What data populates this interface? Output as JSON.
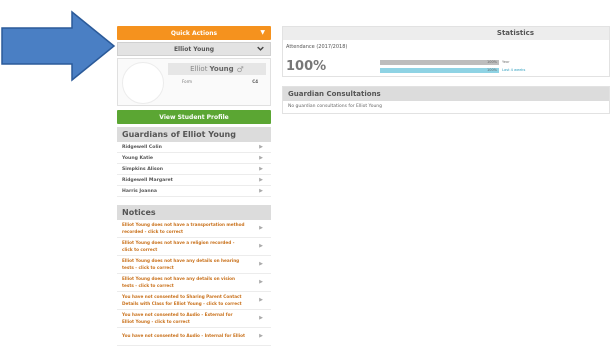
{
  "quick_actions": {
    "label": "Quick Actions",
    "caret": "▼"
  },
  "student_select": {
    "value": "Elliot Young",
    "chevron_icon": "chevron-down-icon"
  },
  "profile": {
    "given_name": "Elliot",
    "family_name": "Young",
    "gender_symbol": "♂",
    "field_label": "Form",
    "field_value": "C4"
  },
  "view_profile_label": "View Student Profile",
  "guardians": {
    "title": "Guardians of Elliot Young",
    "items": [
      {
        "name": "Ridgewell Colin"
      },
      {
        "name": "Young Katie"
      },
      {
        "name": "Simpkins Alison"
      },
      {
        "name": "Ridgewell Margaret"
      },
      {
        "name": "Harris Joanna"
      }
    ]
  },
  "notices": {
    "title": "Notices",
    "items": [
      {
        "text": "Elliot Young does not have a transportation method recorded - click to correct"
      },
      {
        "text": "Elliot Young does not have a religion recorded - click to correct"
      },
      {
        "text": "Elliot Young does not have any details on hearing tests - click to correct"
      },
      {
        "text": "Elliot Young does not have any details on vision tests - click to correct"
      },
      {
        "text": "You have not consented to Sharing Parent Contact Details with Class for Elliot Young - click to correct"
      },
      {
        "text": "You have not consented to Audio - External for Elliot Young - click to correct"
      },
      {
        "text": "You have not consented to Audio - Internal for Elliot"
      }
    ]
  },
  "statistics": {
    "title": "Statistics",
    "attendance_label": "Attendance (2017/2018)",
    "attendance_percent": "100%",
    "bars": [
      {
        "value_text": "100%",
        "caption": "Year",
        "fraction": 1.0,
        "color": "#bdbdbd",
        "caption_color": "#777777"
      },
      {
        "value_text": "100%",
        "caption": "Last 4 weeks",
        "fraction": 1.0,
        "color": "#8fd3e4",
        "caption_color": "#2f9fbf"
      }
    ]
  },
  "guardian_consultations": {
    "title": "Guardian Consultations",
    "empty_text": "No guardian consultations for Elliot Young"
  },
  "colors": {
    "quick_actions_bg": "#f5921e",
    "view_profile_bg": "#5ba633",
    "notice_text": "#c9711b",
    "arrow_fill": "#4a7fc4"
  }
}
